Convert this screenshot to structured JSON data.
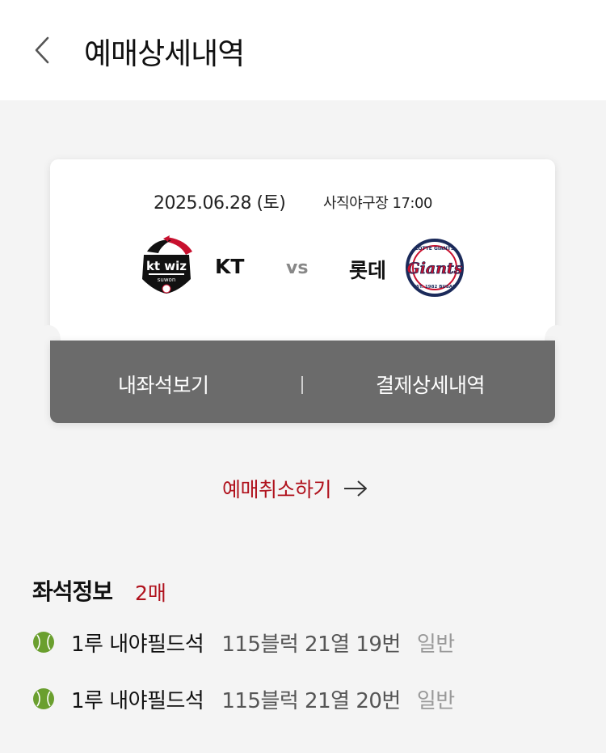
{
  "header": {
    "title": "예매상세내역",
    "back_icon": "chevron-left-icon"
  },
  "ticket": {
    "date": "2025.06.28 (토)",
    "venue_time": "사직야구장 17:00",
    "home_team": {
      "name": "KT",
      "logo": "kt-wiz-logo",
      "logo_text": "kt wiz"
    },
    "away_team": {
      "name": "롯데",
      "logo": "lotte-giants-logo",
      "logo_text": "Giants"
    },
    "vs_label": "vs",
    "actions": {
      "my_seat_label": "내좌석보기",
      "payment_detail_label": "결제상세내역"
    }
  },
  "cancel": {
    "label": "예매취소하기",
    "icon": "arrow-right-icon"
  },
  "seats": {
    "title": "좌석정보",
    "count": "2매",
    "items": [
      {
        "zone": "1루 내야필드석",
        "detail": "115블럭 21열 19번",
        "type": "일반"
      },
      {
        "zone": "1루 내야필드석",
        "detail": "115블럭 21열 20번",
        "type": "일반"
      }
    ]
  },
  "colors": {
    "accent_red": "#b0121d",
    "ticket_bottom": "#6b6b6b",
    "ball_green": "#6a9f2e",
    "background": "#f4f4f4"
  }
}
